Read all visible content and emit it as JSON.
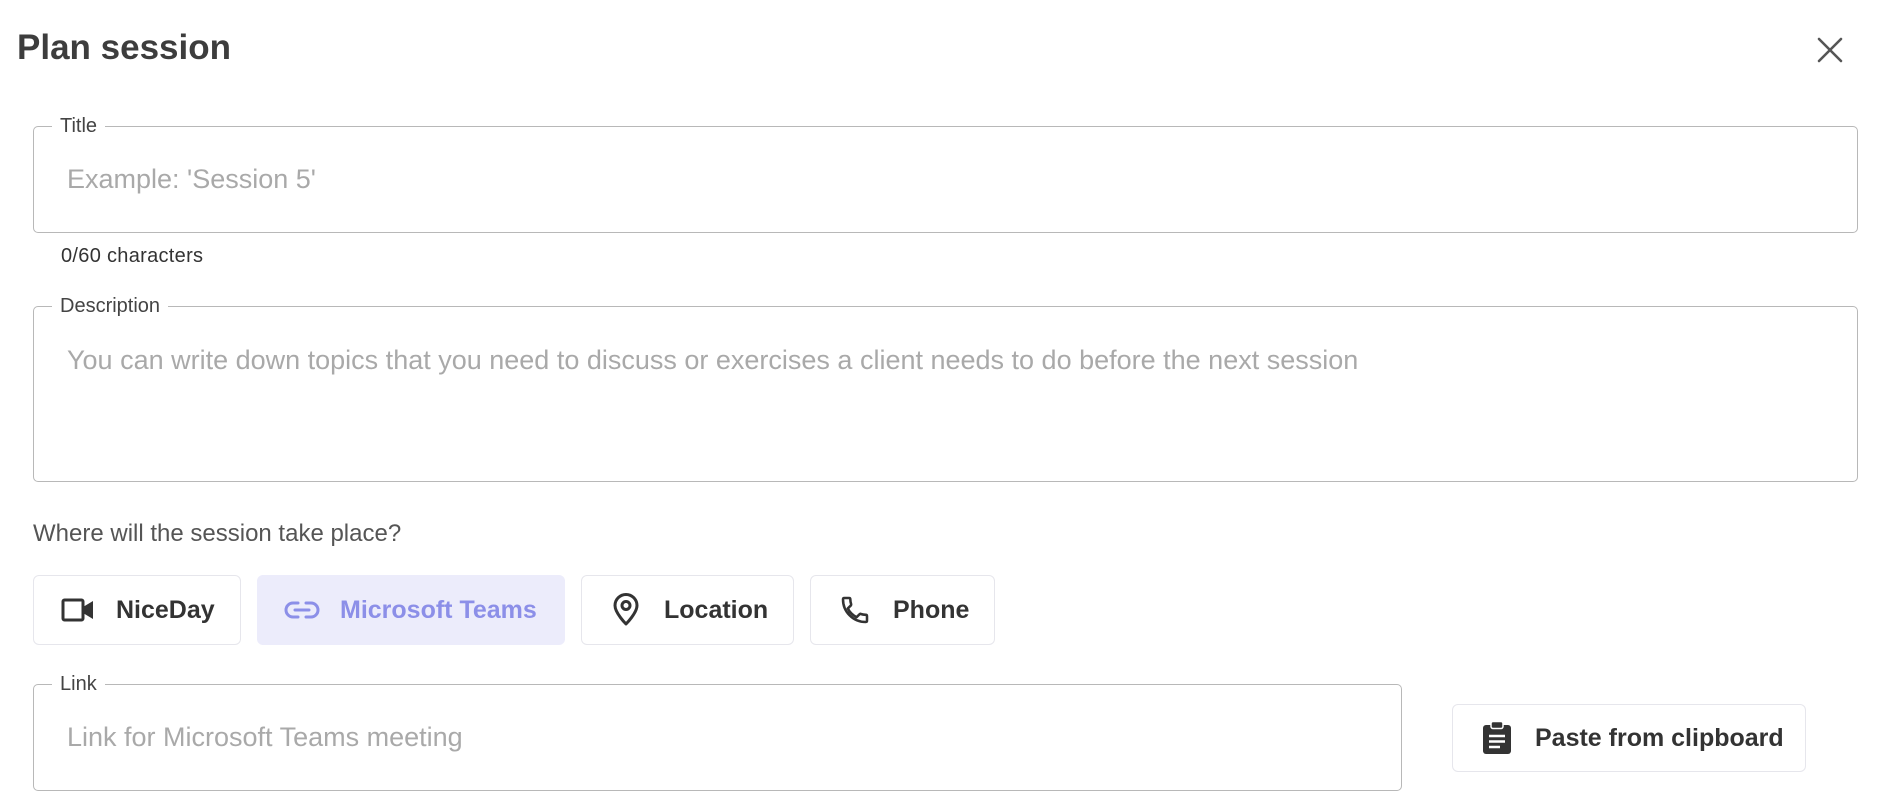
{
  "dialog": {
    "title": "Plan session"
  },
  "title_field": {
    "label": "Title",
    "placeholder": "Example: 'Session 5'",
    "value": "",
    "char_count": "0/60 characters"
  },
  "description_field": {
    "label": "Description",
    "placeholder": "You can write down topics that you need to discuss or exercises a client needs to do before the next session",
    "value": ""
  },
  "location": {
    "question": "Where will the session take place?",
    "selected": "Microsoft Teams",
    "options": [
      {
        "label": "NiceDay",
        "icon": "video-camera-icon"
      },
      {
        "label": "Microsoft Teams",
        "icon": "link-icon"
      },
      {
        "label": "Location",
        "icon": "map-pin-icon"
      },
      {
        "label": "Phone",
        "icon": "phone-icon"
      }
    ]
  },
  "link_field": {
    "label": "Link",
    "placeholder": "Link for Microsoft Teams meeting",
    "value": ""
  },
  "paste_button": {
    "label": "Paste from clipboard",
    "icon": "clipboard-icon"
  },
  "colors": {
    "selected_bg": "#ececfb",
    "selected_text": "#8c8fe8",
    "border": "#b8b8b8"
  }
}
